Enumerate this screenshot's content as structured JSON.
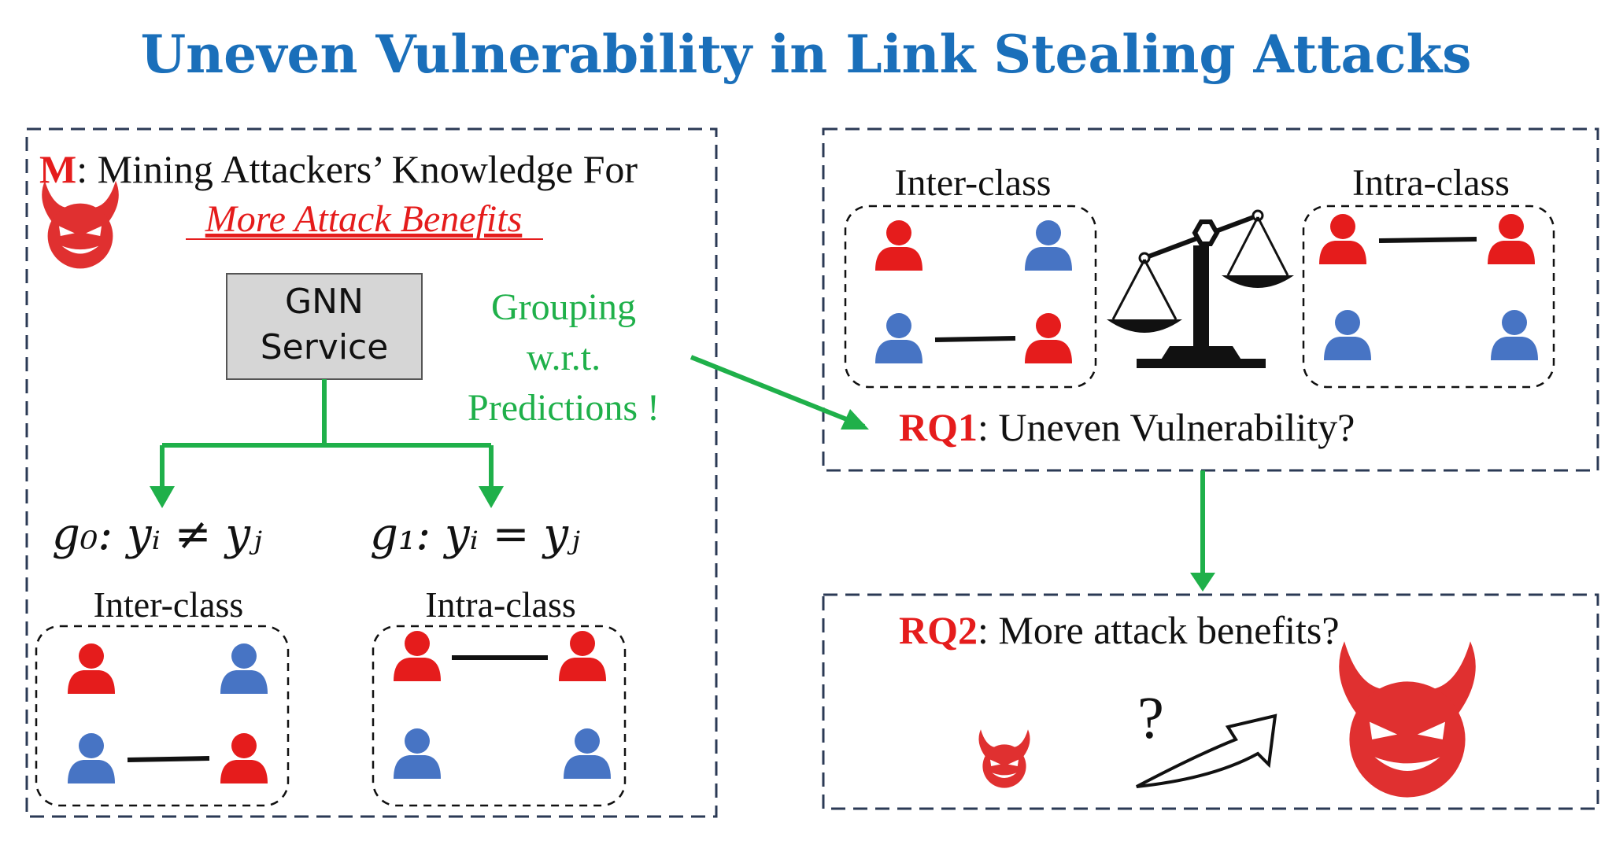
{
  "title": "Uneven Vulnerability in Link Stealing Attacks",
  "left_panel": {
    "mining_letter": "M",
    "mining_text": ": Mining Attackers’ Knowledge For",
    "mining_highlight": "More Attack Benefits",
    "gnn_line1": "GNN",
    "gnn_line2": "Service",
    "grouping_line1": "Grouping",
    "grouping_line2": "w.r.t.",
    "grouping_line3": "Predictions !",
    "g0_label": "g₀: yᵢ ≠ yⱼ",
    "g1_label": "g₁: yᵢ = yⱼ",
    "inter_label": "Inter-class",
    "intra_label": "Intra-class"
  },
  "rq1_panel": {
    "inter_label": "Inter-class",
    "intra_label": "Intra-class",
    "rq_tag": "RQ1",
    "rq_text": ": Uneven Vulnerability?"
  },
  "rq2_panel": {
    "rq_tag": "RQ2",
    "rq_text": ": More attack benefits?",
    "question_mark": "?"
  },
  "colors": {
    "title": "#1a6fba",
    "red": "#e51c1c",
    "blue": "#4774c4",
    "green": "#1fb04a",
    "panel_border": "#2b3a55"
  },
  "icons": [
    "devil-icon",
    "person-icon",
    "scale-icon",
    "arrow-icon"
  ]
}
